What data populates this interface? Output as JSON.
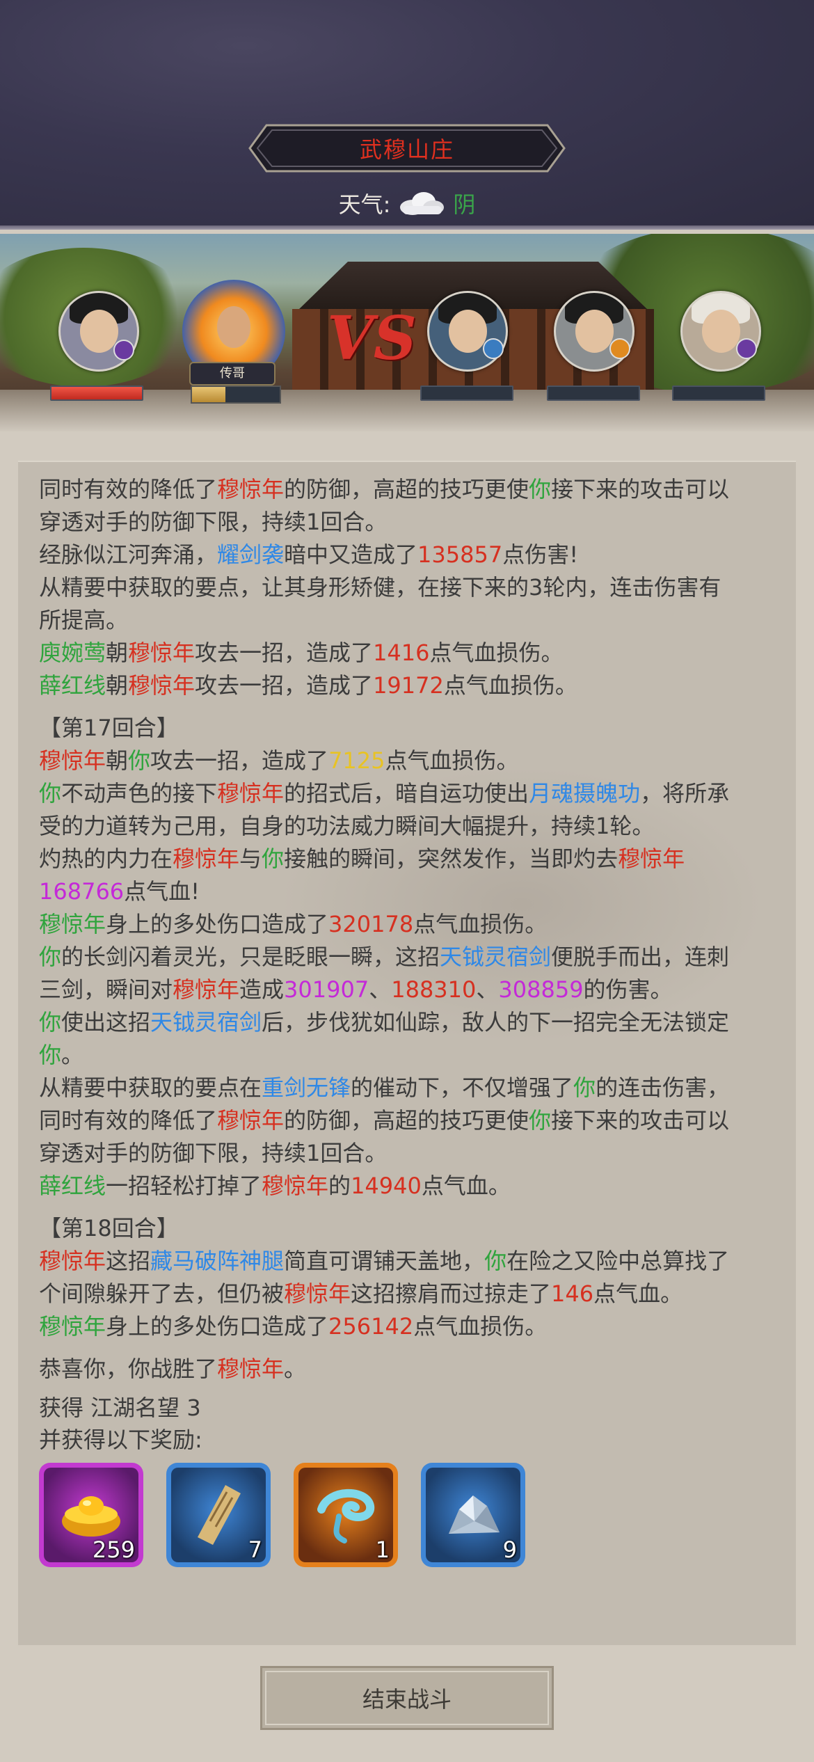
{
  "header": {
    "location": "武穆山庄",
    "weather_label": "天气:",
    "weather_value": "阴",
    "weather_icon": "cloud-icon"
  },
  "battle": {
    "hero_name": "传哥",
    "vs_text": "VS"
  },
  "log": {
    "lines": [
      [
        {
          "t": "同时有效的降低了"
        },
        {
          "t": "穆惊年",
          "c": "r"
        },
        {
          "t": "的防御，高超的技巧更使"
        },
        {
          "t": "你",
          "c": "g"
        },
        {
          "t": "接下来的攻击可以"
        }
      ],
      [
        {
          "t": "穿透对手的防御下限，持续1回合。"
        }
      ],
      [
        {
          "t": "经脉似江河奔涌，"
        },
        {
          "t": "耀剑袭",
          "c": "b"
        },
        {
          "t": "暗中又造成了"
        },
        {
          "t": "135857",
          "c": "r"
        },
        {
          "t": "点伤害!"
        }
      ],
      [
        {
          "t": "从精要中获取的要点，让其身形矫健，在接下来的3轮内，连击伤害有"
        }
      ],
      [
        {
          "t": "所提高。"
        }
      ],
      [
        {
          "t": "庾婉莺",
          "c": "g"
        },
        {
          "t": "朝"
        },
        {
          "t": "穆惊年",
          "c": "r"
        },
        {
          "t": "攻去一招，造成了"
        },
        {
          "t": "1416",
          "c": "r"
        },
        {
          "t": "点气血损伤。"
        }
      ],
      [
        {
          "t": "薛红线",
          "c": "g"
        },
        {
          "t": "朝"
        },
        {
          "t": "穆惊年",
          "c": "r"
        },
        {
          "t": "攻去一招，造成了"
        },
        {
          "t": "19172",
          "c": "r"
        },
        {
          "t": "点气血损伤。"
        }
      ],
      [
        {
          "t": "【第17回合】",
          "gap": true
        }
      ],
      [
        {
          "t": "穆惊年",
          "c": "r"
        },
        {
          "t": "朝"
        },
        {
          "t": "你",
          "c": "g"
        },
        {
          "t": "攻去一招，造成了"
        },
        {
          "t": "7125",
          "c": "y"
        },
        {
          "t": "点气血损伤。"
        }
      ],
      [
        {
          "t": "你",
          "c": "g"
        },
        {
          "t": "不动声色的接下"
        },
        {
          "t": "穆惊年",
          "c": "r"
        },
        {
          "t": "的招式后，暗自运功使出"
        },
        {
          "t": "月魂摄魄功",
          "c": "b"
        },
        {
          "t": "，将所承"
        }
      ],
      [
        {
          "t": "受的力道转为己用，自身的功法威力瞬间大幅提升，持续1轮。"
        }
      ],
      [
        {
          "t": "灼热的内力在"
        },
        {
          "t": "穆惊年",
          "c": "r"
        },
        {
          "t": "与"
        },
        {
          "t": "你",
          "c": "g"
        },
        {
          "t": "接触的瞬间，突然发作，当即灼去"
        },
        {
          "t": "穆惊年",
          "c": "r"
        }
      ],
      [
        {
          "t": "168766",
          "c": "p"
        },
        {
          "t": "点气血!"
        }
      ],
      [
        {
          "t": "穆惊年",
          "c": "g"
        },
        {
          "t": "身上的多处伤口造成了"
        },
        {
          "t": "320178",
          "c": "r"
        },
        {
          "t": "点气血损伤。"
        }
      ],
      [
        {
          "t": "你",
          "c": "g"
        },
        {
          "t": "的长剑闪着灵光，只是眨眼一瞬，这招"
        },
        {
          "t": "天钺灵宿剑",
          "c": "b"
        },
        {
          "t": "便脱手而出，连刺"
        }
      ],
      [
        {
          "t": "三剑，瞬间对"
        },
        {
          "t": "穆惊年",
          "c": "r"
        },
        {
          "t": "造成"
        },
        {
          "t": "301907",
          "c": "p"
        },
        {
          "t": "、"
        },
        {
          "t": "188310",
          "c": "r"
        },
        {
          "t": "、"
        },
        {
          "t": "308859",
          "c": "p"
        },
        {
          "t": "的伤害。"
        }
      ],
      [
        {
          "t": "你",
          "c": "g"
        },
        {
          "t": "使出这招"
        },
        {
          "t": "天钺灵宿剑",
          "c": "b"
        },
        {
          "t": "后，步伐犹如仙踪，敌人的下一招完全无法锁定"
        }
      ],
      [
        {
          "t": "你",
          "c": "g"
        },
        {
          "t": "。"
        }
      ],
      [
        {
          "t": "从精要中获取的要点在"
        },
        {
          "t": "重剑无锋",
          "c": "b"
        },
        {
          "t": "的催动下，不仅增强了"
        },
        {
          "t": "你",
          "c": "g"
        },
        {
          "t": "的连击伤害，"
        }
      ],
      [
        {
          "t": "同时有效的降低了"
        },
        {
          "t": "穆惊年",
          "c": "r"
        },
        {
          "t": "的防御，高超的技巧更使"
        },
        {
          "t": "你",
          "c": "g"
        },
        {
          "t": "接下来的攻击可以"
        }
      ],
      [
        {
          "t": "穿透对手的防御下限，持续1回合。"
        }
      ],
      [
        {
          "t": "薛红线",
          "c": "g"
        },
        {
          "t": "一招轻松打掉了"
        },
        {
          "t": "穆惊年",
          "c": "r"
        },
        {
          "t": "的"
        },
        {
          "t": "14940",
          "c": "r"
        },
        {
          "t": "点气血。"
        }
      ],
      [
        {
          "t": "【第18回合】",
          "gap": true
        }
      ],
      [
        {
          "t": "穆惊年",
          "c": "r"
        },
        {
          "t": "这招"
        },
        {
          "t": "藏马破阵神腿",
          "c": "b"
        },
        {
          "t": "简直可谓铺天盖地，"
        },
        {
          "t": "你",
          "c": "g"
        },
        {
          "t": "在险之又险中总算找了"
        }
      ],
      [
        {
          "t": "个间隙躲开了去，但仍被"
        },
        {
          "t": "穆惊年",
          "c": "r"
        },
        {
          "t": "这招擦肩而过掠走了"
        },
        {
          "t": "146",
          "c": "r"
        },
        {
          "t": "点气血。"
        }
      ],
      [
        {
          "t": "穆惊年",
          "c": "g"
        },
        {
          "t": "身上的多处伤口造成了"
        },
        {
          "t": "256142",
          "c": "r"
        },
        {
          "t": "点气血损伤。"
        }
      ],
      [
        {
          "t": "恭喜你，你战胜了",
          "gap": true
        },
        {
          "t": "穆惊年",
          "c": "r"
        },
        {
          "t": "。"
        }
      ]
    ]
  },
  "rewards": {
    "fame_line": "获得 江湖名望 3",
    "intro": "并获得以下奖励:",
    "items": [
      {
        "name": "gold-ingot-icon",
        "qty": "259",
        "frame": "#c23ad0",
        "bg": "#5a1a6a"
      },
      {
        "name": "scroll-icon",
        "qty": "7",
        "frame": "#3f86d6",
        "bg": "#1c3e6a"
      },
      {
        "name": "blue-swirl-icon",
        "qty": "1",
        "frame": "#e5801c",
        "bg": "#6a2e10"
      },
      {
        "name": "ore-crystal-icon",
        "qty": "9",
        "frame": "#3f86d6",
        "bg": "#1c3e6a"
      }
    ]
  },
  "end_button": "结束战斗",
  "colors": {
    "red": "#d63020",
    "green": "#2fa43d",
    "blue": "#2f88e6",
    "yellow": "#e8c324",
    "purple": "#c429d8"
  }
}
